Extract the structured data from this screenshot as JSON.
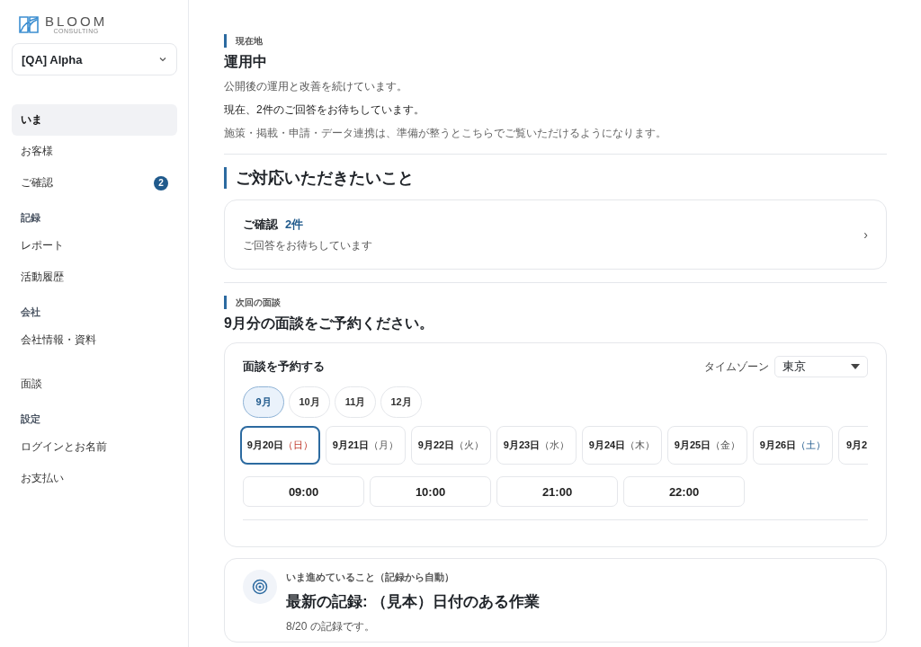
{
  "sidebar": {
    "logo": {
      "name": "BLOOM",
      "tagline": "CONSULTING"
    },
    "account": "[QA] Alpha",
    "groups": [
      {
        "items": [
          {
            "label": "いま",
            "selected": true
          },
          {
            "label": "お客様",
            "selected": false
          },
          {
            "label": "ご確認",
            "selected": false,
            "badge": "2"
          }
        ]
      },
      {
        "heading": "記録",
        "items": [
          {
            "label": "レポート",
            "selected": false
          },
          {
            "label": "活動履歴",
            "selected": false
          }
        ]
      },
      {
        "heading": "会社",
        "items": [
          {
            "label": "会社情報・資料",
            "selected": false
          }
        ]
      },
      {
        "items": [
          {
            "label": "面談",
            "selected": false
          }
        ]
      },
      {
        "heading": "設定",
        "items": [
          {
            "label": "ログインとお名前",
            "selected": false
          },
          {
            "label": "お支払い",
            "selected": false
          }
        ]
      }
    ]
  },
  "status": {
    "eyebrow": "現在地",
    "title": "運用中",
    "lines": [
      "公開後の運用と改善を続けています。",
      "現在、2件のご回答をお待ちしています。",
      "施策・掲載・申請・データ連携は、準備が整うとこちらでご覧いただけるようになります。"
    ]
  },
  "actions": {
    "heading": "ご対応いただきたいこと",
    "card": {
      "title": "ご確認",
      "count": "2件",
      "subtitle": "ご回答をお待ちしています",
      "chevron": "›"
    }
  },
  "meeting": {
    "eyebrow": "次回の面談",
    "title": "9月分の面談をご予約ください。",
    "card_title": "面談を予約する",
    "timezone_label": "タイムゾーン",
    "timezone": "東京",
    "months": [
      {
        "label": "9月",
        "selected": true
      },
      {
        "label": "10月",
        "selected": false
      },
      {
        "label": "11月",
        "selected": false
      },
      {
        "label": "12月",
        "selected": false
      }
    ],
    "days": [
      {
        "date": "9月20日",
        "weekday": "（日）",
        "kind": "sunday",
        "selected": true
      },
      {
        "date": "9月21日",
        "weekday": "（月）",
        "kind": "weekday",
        "selected": false
      },
      {
        "date": "9月22日",
        "weekday": "（火）",
        "kind": "weekday",
        "selected": false
      },
      {
        "date": "9月23日",
        "weekday": "（水）",
        "kind": "weekday",
        "selected": false
      },
      {
        "date": "9月24日",
        "weekday": "（木）",
        "kind": "weekday",
        "selected": false
      },
      {
        "date": "9月25日",
        "weekday": "（金）",
        "kind": "weekday",
        "selected": false
      },
      {
        "date": "9月26日",
        "weekday": "（土）",
        "kind": "saturday",
        "selected": false
      },
      {
        "date": "9月2",
        "kind": "weekday",
        "selected": false
      }
    ],
    "times": [
      "09:00",
      "10:00",
      "21:00",
      "22:00"
    ]
  },
  "progress": {
    "eyebrow": "いま進めていること（記録から自動）",
    "title": "最新の記録: （見本）日付のある作業",
    "note": "8/20 の記録です。"
  }
}
